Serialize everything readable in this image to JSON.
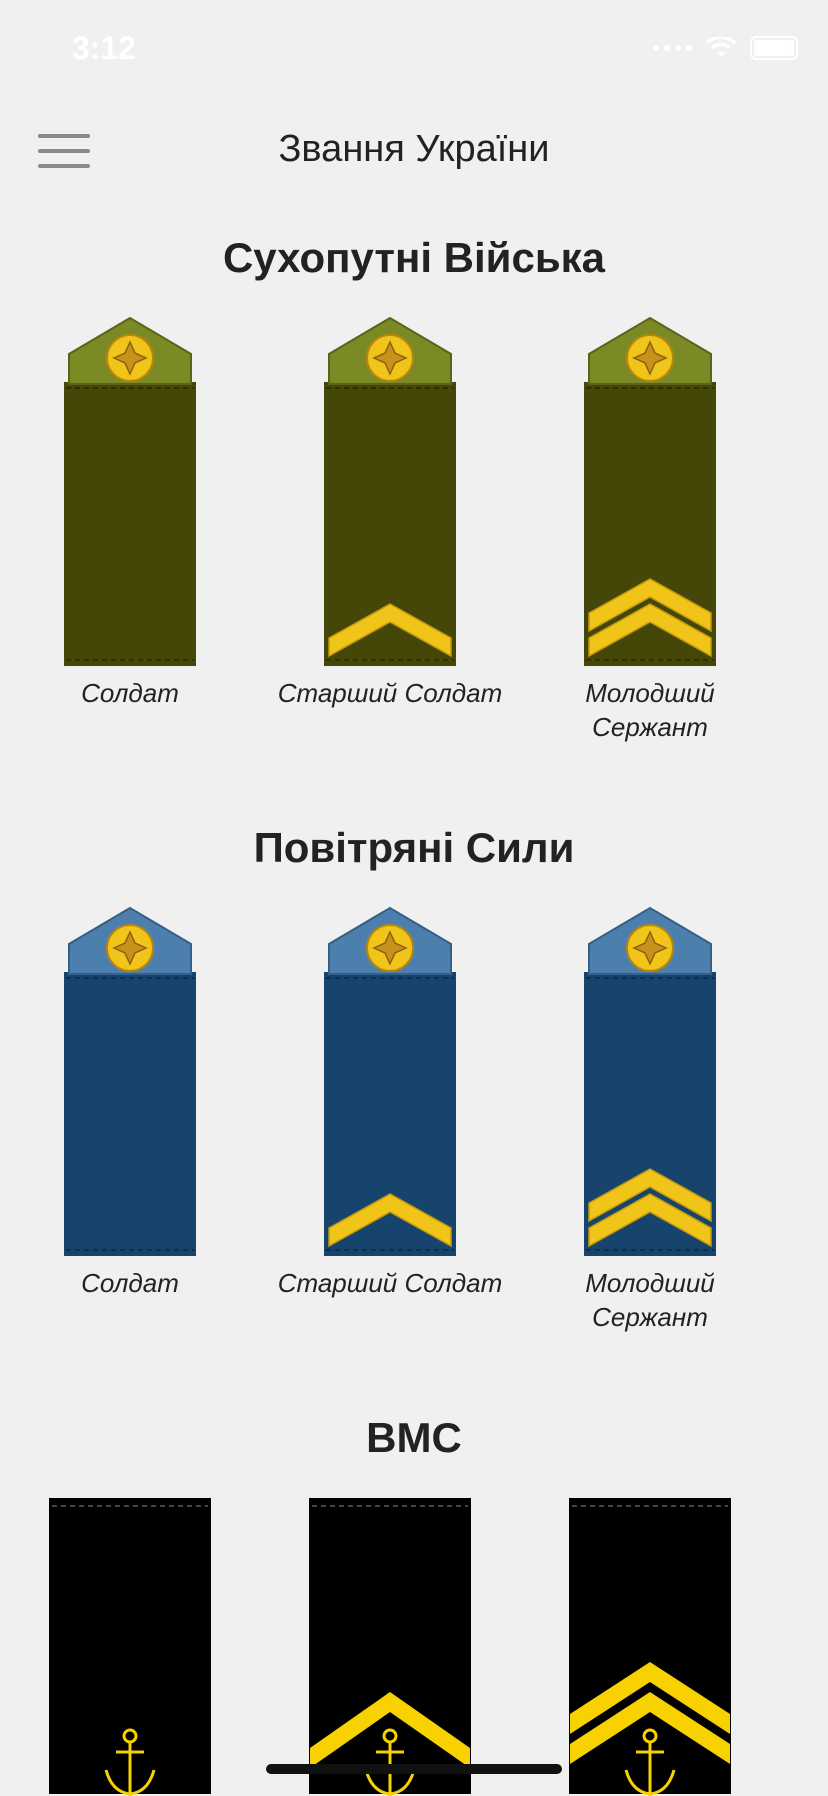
{
  "status_bar": {
    "time": "3:12"
  },
  "nav": {
    "title": "Звання України",
    "menu_icon": "hamburger-icon"
  },
  "sections": [
    {
      "title": "Сухопутні Війська",
      "colors": {
        "board": "#454709",
        "cap": "#7c8a26",
        "stripe": "#f1c419"
      },
      "ranks": [
        {
          "label": "Солдат",
          "chevrons": 0
        },
        {
          "label": "Старший Солдат",
          "chevrons": 1
        },
        {
          "label_line1": "Молодший",
          "label_line2": "Сержант",
          "chevrons": 2
        }
      ]
    },
    {
      "title": "Повітряні Сили",
      "colors": {
        "board": "#17446d",
        "cap": "#4d7fae",
        "stripe": "#f1c419"
      },
      "ranks": [
        {
          "label": "Солдат",
          "chevrons": 0
        },
        {
          "label": "Старший Солдат",
          "chevrons": 1
        },
        {
          "label_line1": "Молодший",
          "label_line2": "Сержант",
          "chevrons": 2
        }
      ]
    },
    {
      "title": "ВМС",
      "colors": {
        "board": "#000000",
        "stripe": "#f7d100"
      },
      "ranks": [
        {
          "chevrons": 0
        },
        {
          "chevrons": 1
        },
        {
          "chevrons": 2
        }
      ]
    }
  ]
}
